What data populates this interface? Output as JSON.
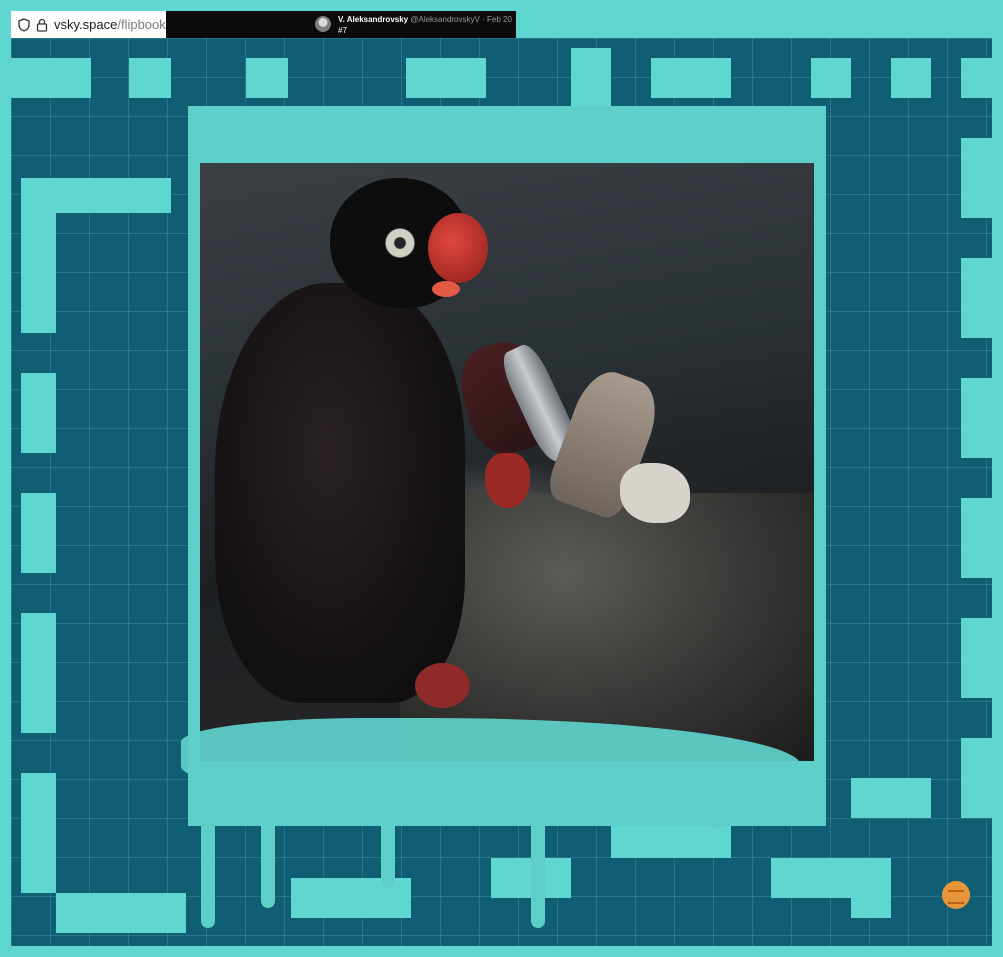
{
  "browser": {
    "url_host": "vsky.space",
    "url_path": "/flipbook/",
    "shield_icon": "shield-icon",
    "lock_icon": "lock-icon"
  },
  "tweet": {
    "author_name": "V. Aleksandrovsky",
    "handle": "@AleksandrovskyV",
    "separator": "·",
    "date": "Feb 20",
    "text": "#7"
  },
  "colors": {
    "frame": "#5fd6cf",
    "background": "#0f5e73",
    "accent": "#e8953a"
  }
}
